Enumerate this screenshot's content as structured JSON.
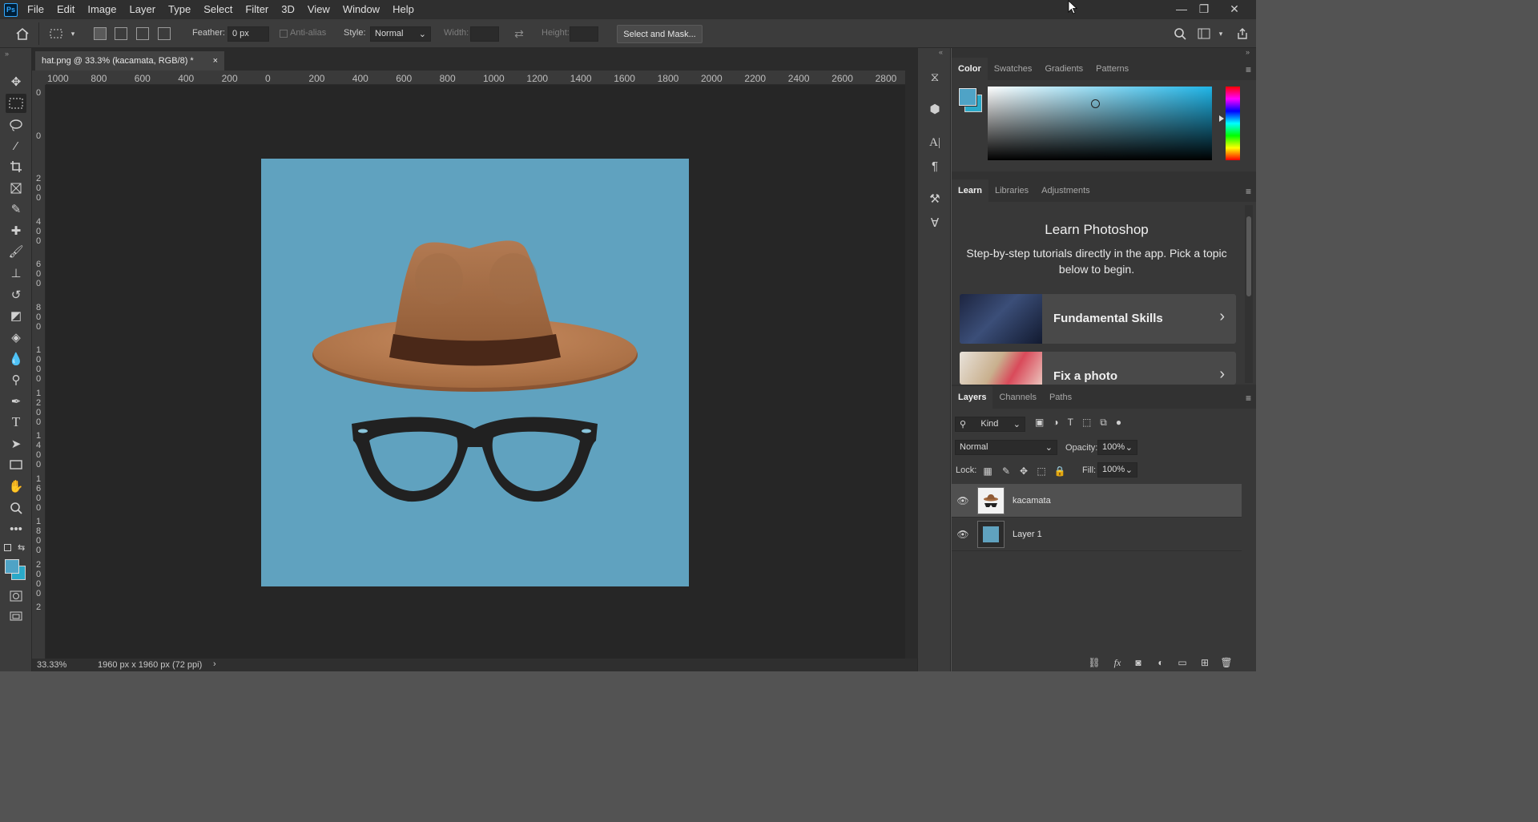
{
  "app": {
    "logo": "Ps"
  },
  "menu": [
    "File",
    "Edit",
    "Image",
    "Layer",
    "Type",
    "Select",
    "Filter",
    "3D",
    "View",
    "Window",
    "Help"
  ],
  "window_controls": {
    "minimize": "—",
    "restore": "❐",
    "close": "✕"
  },
  "options": {
    "feather_label": "Feather:",
    "feather_value": "0 px",
    "antialias_label": "Anti-alias",
    "style_label": "Style:",
    "style_value": "Normal",
    "width_label": "Width:",
    "height_label": "Height:",
    "select_mask_label": "Select and Mask..."
  },
  "document": {
    "tab_title": "hat.png @ 33.3% (kacamata, RGB/8) *",
    "close": "×",
    "zoom": "33.33%",
    "size_info": "1960 px x 1960 px (72 ppi)",
    "status_arrow": "›",
    "background_color": "#60a2bf"
  },
  "rulers": {
    "top": [
      "1000",
      "800",
      "600",
      "400",
      "200",
      "0",
      "200",
      "400",
      "600",
      "800",
      "1000",
      "1200",
      "1400",
      "1600",
      "1800",
      "2000",
      "2200",
      "2400",
      "2600",
      "2800"
    ],
    "left": [
      "0",
      "0",
      "2 0 0",
      "4 0 0",
      "6 0 0",
      "8 0 0",
      "1 0 0 0",
      "1 2 0 0",
      "1 4 0 0",
      "1 6 0 0",
      "1 8 0 0",
      "2 0 0 0",
      "2"
    ]
  },
  "color_panel": {
    "tabs": [
      "Color",
      "Swatches",
      "Gradients",
      "Patterns"
    ],
    "active_tab": "Color",
    "foreground": "#4fa3c6",
    "background": "#2aa9c8",
    "field_hue": "#1fb5e8"
  },
  "learn_panel": {
    "tabs": [
      "Learn",
      "Libraries",
      "Adjustments"
    ],
    "active_tab": "Learn",
    "heading": "Learn Photoshop",
    "description": "Step-by-step tutorials directly in the app. Pick a topic below to begin.",
    "cards": [
      {
        "title": "Fundamental Skills",
        "arrow": "›"
      },
      {
        "title": "Fix a photo",
        "arrow": "›"
      }
    ]
  },
  "layers_panel": {
    "tabs": [
      "Layers",
      "Channels",
      "Paths"
    ],
    "active_tab": "Layers",
    "filter_kind": "Kind",
    "blend_mode": "Normal",
    "opacity_label": "Opacity:",
    "opacity_value": "100%",
    "lock_label": "Lock:",
    "fill_label": "Fill:",
    "fill_value": "100%",
    "layers": [
      {
        "name": "kacamata",
        "selected": true
      },
      {
        "name": "Layer 1",
        "selected": false
      }
    ]
  }
}
